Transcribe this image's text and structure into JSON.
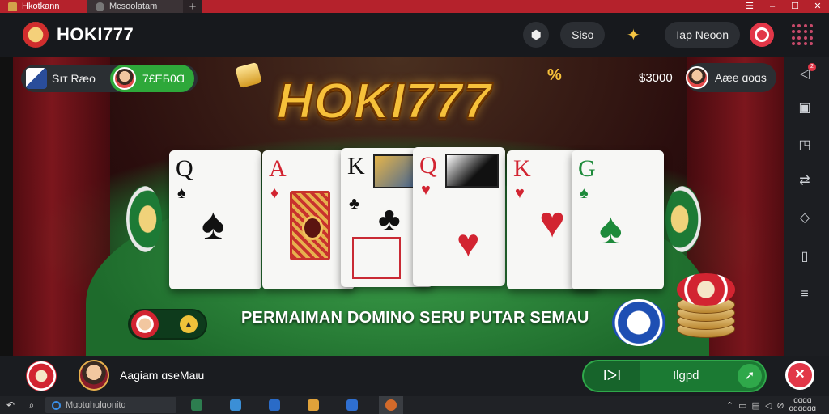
{
  "browser": {
    "tabs": [
      {
        "label": "Hkotkann"
      },
      {
        "label": "Mcsoolatam"
      }
    ],
    "new_tab": "+",
    "window_controls": [
      "☰",
      "–",
      "☐",
      "✕"
    ]
  },
  "header": {
    "title": "HOKI777",
    "pill_label": "Siso",
    "account_label": "Iap Neoon"
  },
  "stage": {
    "left_player": {
      "name": "Sıт Ræo",
      "balance": "7£ЕБ0Ɑ"
    },
    "right_player": {
      "amount": "$3000",
      "name": "Aæe ɑoɑs"
    },
    "logo_text": "HOKI777",
    "logo_mark": "%",
    "tagline": "PERMAIMAN DOMINO SERU PUTAR SEMAU",
    "cards": [
      {
        "rank": "Q",
        "suit": "♠",
        "color": "black"
      },
      {
        "rank": "A",
        "suit": "♦",
        "color": "red"
      },
      {
        "rank": "K",
        "suit": "♣",
        "color": "black"
      },
      {
        "rank": "Q",
        "suit": "♥",
        "color": "red"
      },
      {
        "rank": "K",
        "suit": "♥",
        "color": "red"
      },
      {
        "rank": "G",
        "suit": "♠",
        "color": "green"
      }
    ]
  },
  "bottom": {
    "player_name": "Aagiam ɑseMaιu",
    "play_left_label": "ⅠᐳⅠ",
    "play_label": "Ilgpd",
    "play_arrow": "➚",
    "close_symbol": "✕"
  },
  "sidebar": {
    "notification_count": "2"
  },
  "taskbar": {
    "search_placeholder": "Mɑɔtɑhɑlɑonitɑ",
    "clock_line1": "ɑɑɑɑ",
    "clock_line2": "ɑɑɑɑɑɑ"
  },
  "colors": {
    "tab_red": "#b5222c",
    "play_green": "#1b7a33",
    "logo_gold": "#f6c13a",
    "accent_red": "#e23748"
  }
}
